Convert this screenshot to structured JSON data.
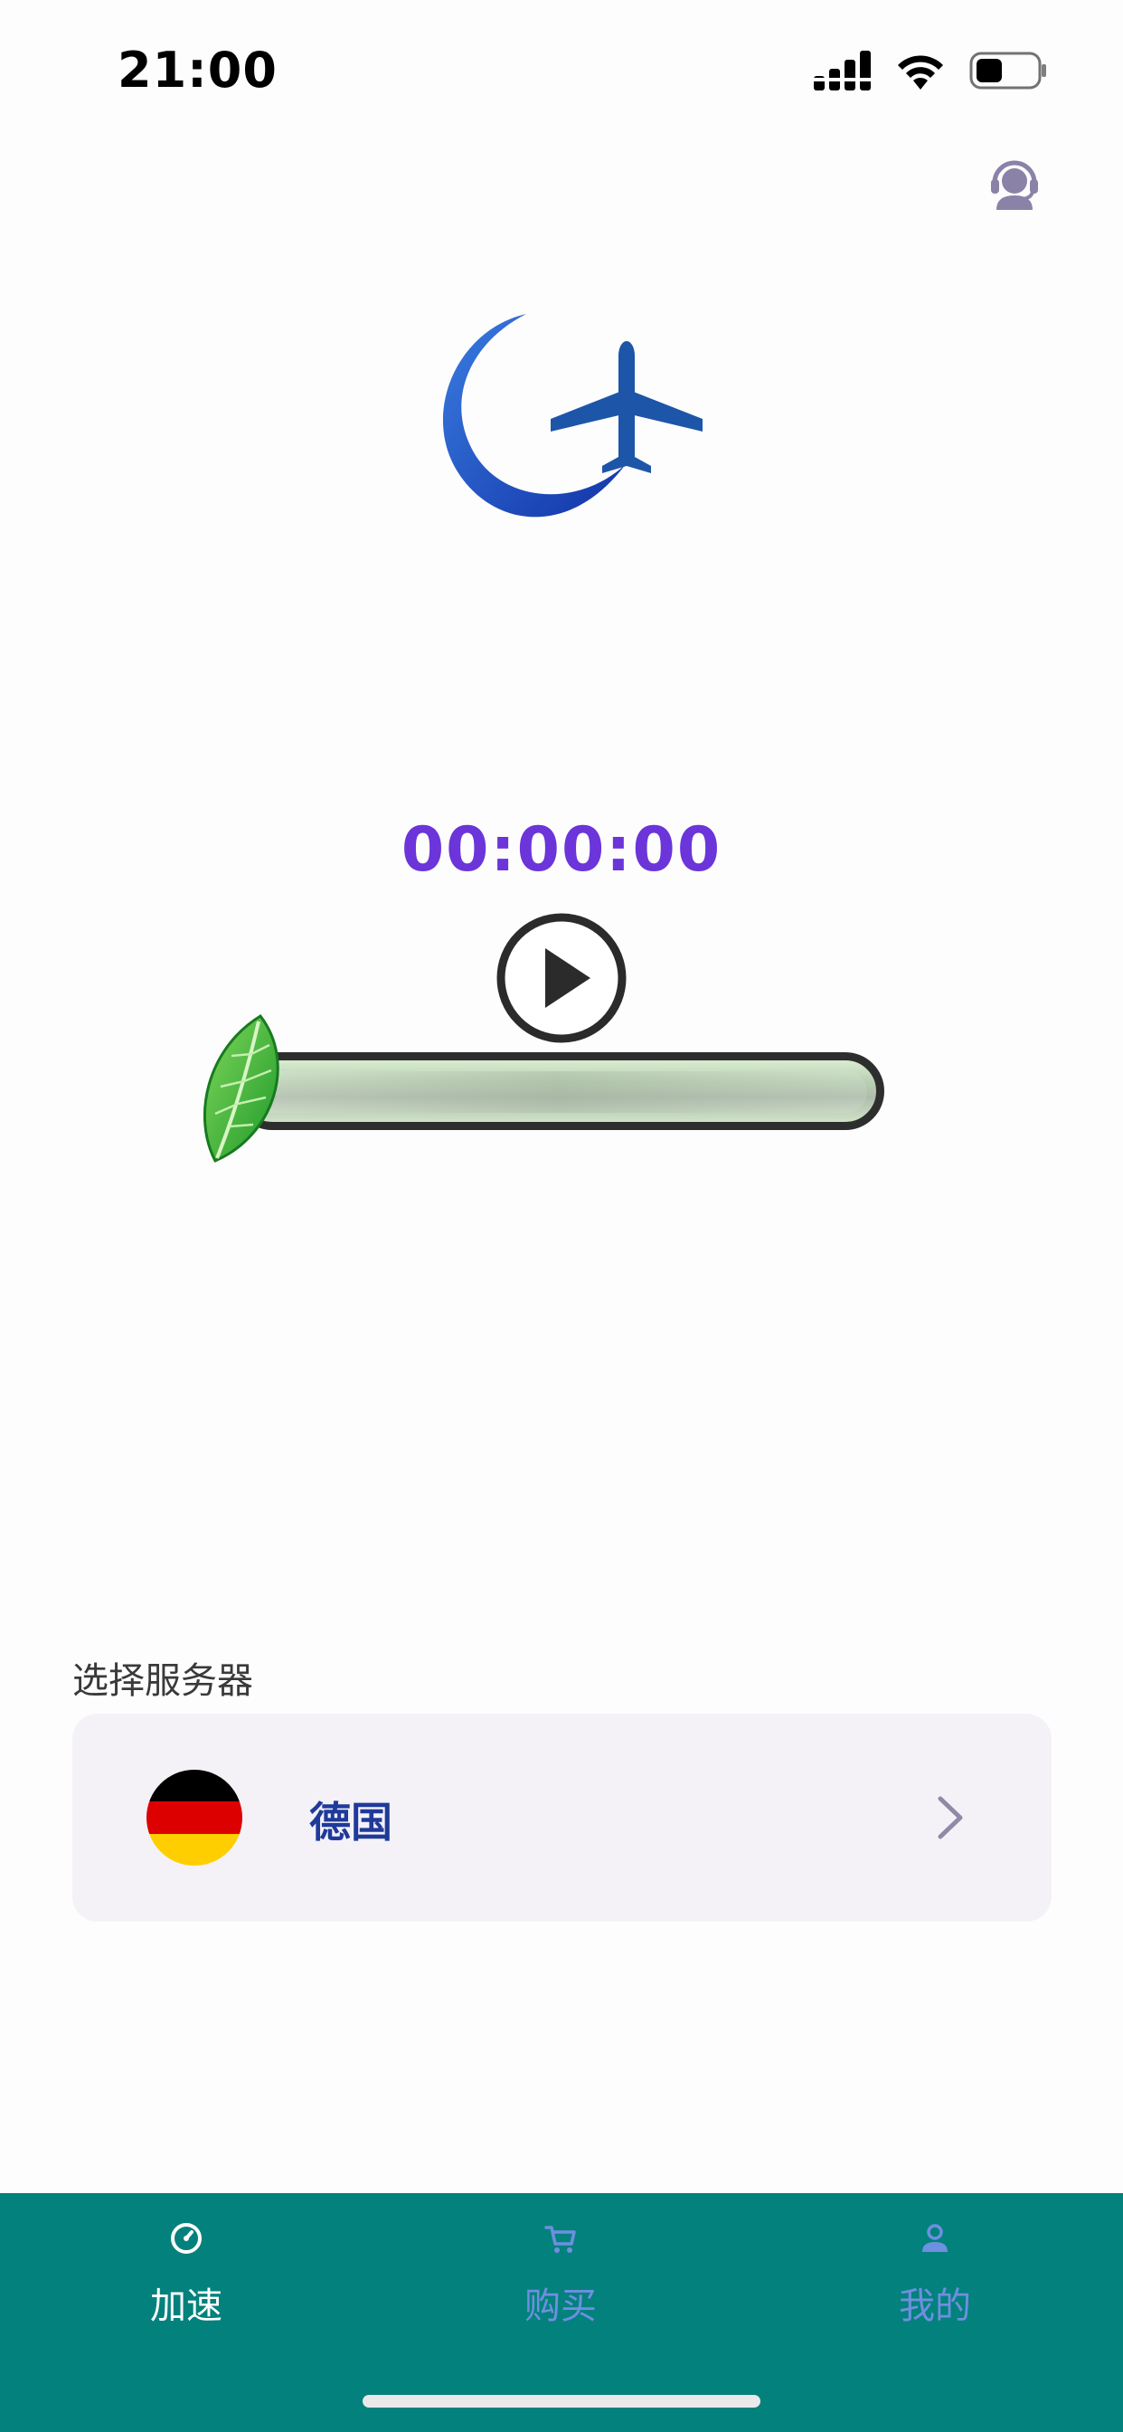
{
  "status_bar": {
    "time": "21:00",
    "icons": [
      "signal-icon",
      "wifi-icon",
      "battery-icon"
    ]
  },
  "header": {
    "support_icon": "customer-service-icon"
  },
  "logo": {
    "icon": "crescent-airplane-logo"
  },
  "timer": {
    "value": "00:00:00",
    "color": "#6b35d9"
  },
  "connect": {
    "icon": "play-icon"
  },
  "progress": {
    "value": 0,
    "icon": "leaf-icon"
  },
  "server": {
    "section_label": "选择服务器",
    "name": "德国",
    "flag": "germany-flag",
    "flag_colors": [
      "#000000",
      "#dd0000",
      "#ffce00"
    ]
  },
  "tabs": [
    {
      "label": "加速",
      "icon": "speed-icon",
      "active": true
    },
    {
      "label": "购买",
      "icon": "cart-icon",
      "active": false
    },
    {
      "label": "我的",
      "icon": "user-icon",
      "active": false
    }
  ],
  "colors": {
    "tabbar_bg": "#03817d",
    "tab_active": "#ffffff",
    "tab_inactive": "#6f8fe0",
    "accent": "#6b35d9"
  }
}
